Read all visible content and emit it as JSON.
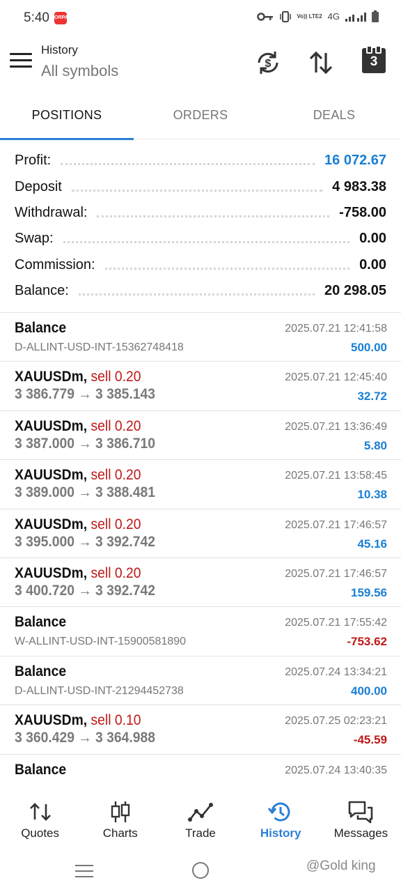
{
  "status_bar": {
    "time": "5:40",
    "badge": "ORPA",
    "network_small": "Vo)) LTE2",
    "network": "4G",
    "icons": [
      "key-icon",
      "vibrate-icon",
      "signal-icon",
      "battery-icon"
    ]
  },
  "header": {
    "title": "History",
    "subtitle": "All symbols",
    "calendar_day": "3",
    "icons": [
      "menu-icon",
      "currency-swap-icon",
      "sort-icon",
      "calendar-icon"
    ]
  },
  "tabs": [
    {
      "label": "POSITIONS",
      "active": true
    },
    {
      "label": "ORDERS",
      "active": false
    },
    {
      "label": "DEALS",
      "active": false
    }
  ],
  "summary": {
    "profit": {
      "label": "Profit:",
      "value": "16 072.67"
    },
    "deposit": {
      "label": "Deposit",
      "value": "4 983.38"
    },
    "withdrawal": {
      "label": "Withdrawal:",
      "value": "-758.00"
    },
    "swap": {
      "label": "Swap:",
      "value": "0.00"
    },
    "commission": {
      "label": "Commission:",
      "value": "0.00"
    },
    "balance": {
      "label": "Balance:",
      "value": "20 298.05"
    }
  },
  "deals": [
    {
      "type": "balance",
      "title": "Balance",
      "sub": "D-ALLINT-USD-INT-15362748418",
      "time": "2025.07.21 12:41:58",
      "profit": "500.00",
      "sign": "pos"
    },
    {
      "type": "trade",
      "symbol": "XAUUSDm,",
      "side": "sell 0.20",
      "sub": "3 386.779 → 3 385.143",
      "time": "2025.07.21 12:45:40",
      "profit": "32.72",
      "sign": "pos"
    },
    {
      "type": "trade",
      "symbol": "XAUUSDm,",
      "side": "sell 0.20",
      "sub": "3 387.000 → 3 386.710",
      "time": "2025.07.21 13:36:49",
      "profit": "5.80",
      "sign": "pos"
    },
    {
      "type": "trade",
      "symbol": "XAUUSDm,",
      "side": "sell 0.20",
      "sub": "3 389.000 → 3 388.481",
      "time": "2025.07.21 13:58:45",
      "profit": "10.38",
      "sign": "pos"
    },
    {
      "type": "trade",
      "symbol": "XAUUSDm,",
      "side": "sell 0.20",
      "sub": "3 395.000 → 3 392.742",
      "time": "2025.07.21 17:46:57",
      "profit": "45.16",
      "sign": "pos"
    },
    {
      "type": "trade",
      "symbol": "XAUUSDm,",
      "side": "sell 0.20",
      "sub": "3 400.720 → 3 392.742",
      "time": "2025.07.21 17:46:57",
      "profit": "159.56",
      "sign": "pos"
    },
    {
      "type": "balance",
      "title": "Balance",
      "sub": "W-ALLINT-USD-INT-15900581890",
      "time": "2025.07.21 17:55:42",
      "profit": "-753.62",
      "sign": "neg"
    },
    {
      "type": "balance",
      "title": "Balance",
      "sub": "D-ALLINT-USD-INT-21294452738",
      "time": "2025.07.24 13:34:21",
      "profit": "400.00",
      "sign": "pos"
    },
    {
      "type": "trade",
      "symbol": "XAUUSDm,",
      "side": "sell 0.10",
      "sub": "3 360.429 → 3 364.988",
      "time": "2025.07.25 02:23:21",
      "profit": "-45.59",
      "sign": "neg"
    },
    {
      "type": "balance",
      "title": "Balance",
      "sub": "",
      "time": "2025.07.24 13:40:35",
      "profit": "",
      "sign": "pos"
    }
  ],
  "bottom_nav": [
    {
      "label": "Quotes",
      "icon": "quotes-icon",
      "active": false
    },
    {
      "label": "Charts",
      "icon": "candlestick-chart-icon",
      "active": false
    },
    {
      "label": "Trade",
      "icon": "trade-line-icon",
      "active": false
    },
    {
      "label": "History",
      "icon": "history-icon",
      "active": true
    },
    {
      "label": "Messages",
      "icon": "messages-icon",
      "active": false
    }
  ],
  "watermark": "@Gold king",
  "colors": {
    "accent": "#2a7fd6",
    "profit_positive": "#1a7fd4",
    "profit_negative": "#c01818"
  }
}
